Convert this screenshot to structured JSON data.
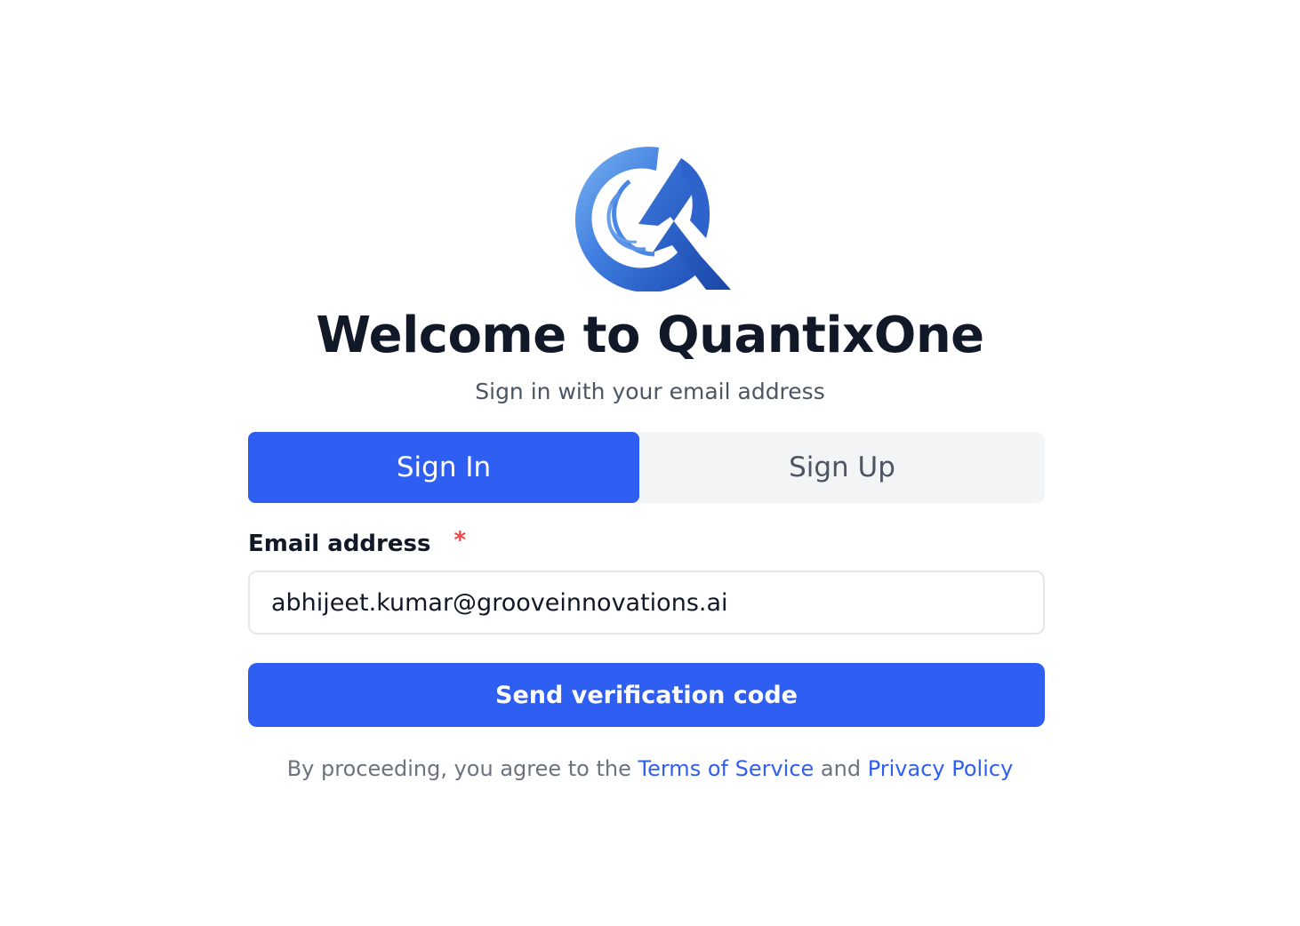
{
  "header": {
    "title": "Welcome to QuantixOne",
    "subtitle": "Sign in with your email address"
  },
  "tabs": [
    {
      "label": "Sign In",
      "active": true
    },
    {
      "label": "Sign Up",
      "active": false
    }
  ],
  "form": {
    "email_label": "Email address",
    "required_mark": "*",
    "email_value": "abhijeet.kumar@grooveinnovations.ai",
    "submit_label": "Send verification code"
  },
  "legal": {
    "prefix": "By proceeding, you agree to the",
    "terms_label": "Terms of Service",
    "conjunction": "and",
    "privacy_label": "Privacy Policy"
  },
  "colors": {
    "accent": "#2f5ef3",
    "required": "#ef4444",
    "tab_background": "#f3f4f6"
  },
  "icons": {
    "logo": "quantixone-q-logo-icon"
  }
}
